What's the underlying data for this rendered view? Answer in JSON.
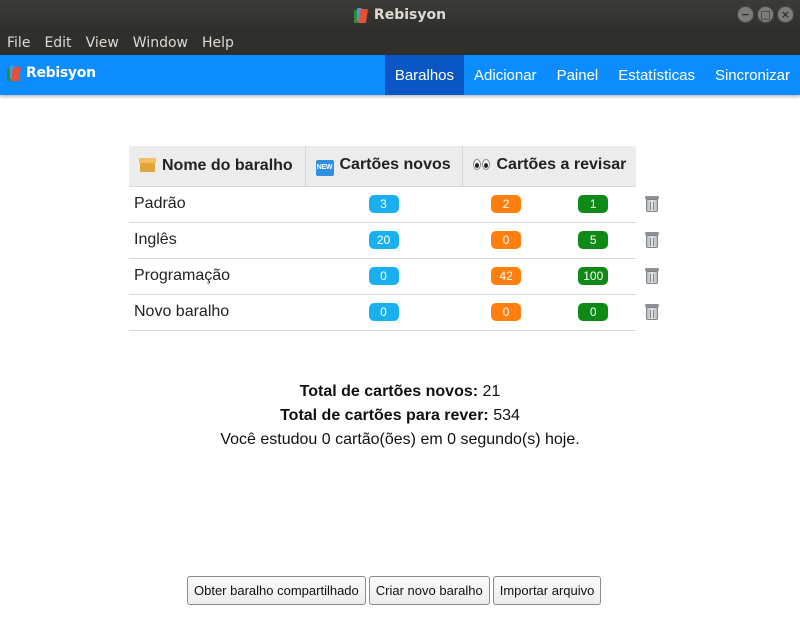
{
  "window": {
    "title": "Rebisyon",
    "controls": {
      "minimize": "−",
      "maximize": "□",
      "close": "×"
    }
  },
  "menubar": {
    "items": [
      "File",
      "Edit",
      "View",
      "Window",
      "Help"
    ]
  },
  "navbar": {
    "brand": "Rebisyon",
    "links": [
      {
        "label": "Baralhos",
        "active": true
      },
      {
        "label": "Adicionar",
        "active": false
      },
      {
        "label": "Painel",
        "active": false
      },
      {
        "label": "Estatísticas",
        "active": false
      },
      {
        "label": "Sincronizar",
        "active": false
      }
    ]
  },
  "table": {
    "headers": {
      "name": "Nome do baralho",
      "new": "Cartões novos",
      "review": "Cartões a revisar"
    },
    "rows": [
      {
        "name": "Padrão",
        "new": "3",
        "learning": "2",
        "review": "1"
      },
      {
        "name": "Inglês",
        "new": "20",
        "learning": "0",
        "review": "5"
      },
      {
        "name": "Programação",
        "new": "0",
        "learning": "42",
        "review": "100"
      },
      {
        "name": "Novo baralho",
        "new": "0",
        "learning": "0",
        "review": "0"
      }
    ]
  },
  "summary": {
    "total_new_label": "Total de cartões novos:",
    "total_new_value": "21",
    "total_review_label": "Total de cartões para rever:",
    "total_review_value": "534",
    "studied_text": "Você estudou 0 cartão(ões) em 0 segundo(s) hoje."
  },
  "buttons": {
    "shared": "Obter baralho compartilhado",
    "create": "Criar novo baralho",
    "import": "Importar arquivo"
  },
  "colors": {
    "navbar": "#0d8cff",
    "nav_active": "#0a56c4",
    "badge_new": "#1ab0f0",
    "badge_learning": "#ff7f0e",
    "badge_review": "#108a17"
  },
  "icons": {
    "app": "books-icon",
    "name_header": "package-icon",
    "new_header": "new-icon",
    "review_header": "eyes-icon",
    "delete": "trash-icon"
  }
}
